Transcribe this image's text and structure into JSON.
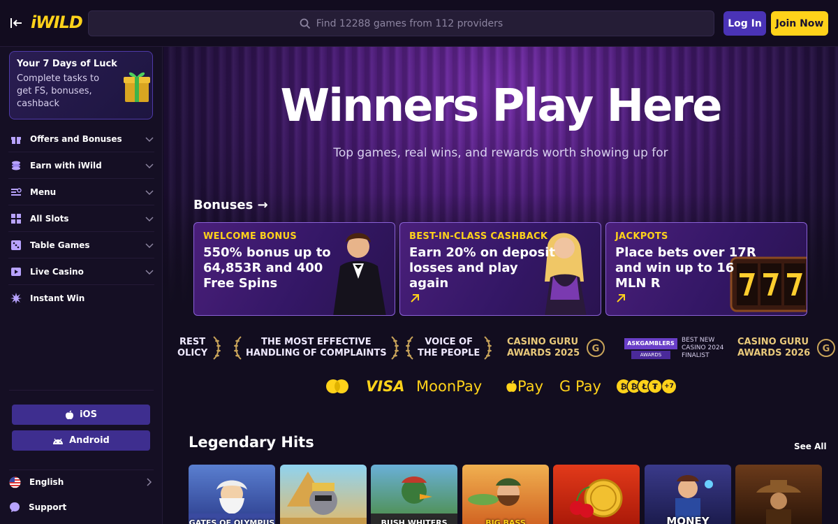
{
  "header": {
    "logo": "iWILD",
    "search_placeholder": "Find 12288 games from 112 providers",
    "login_label": "Log In",
    "join_label": "Join Now"
  },
  "sidebar": {
    "luck_card": {
      "title": "Your 7 Days of Luck",
      "description": "Complete tasks to get FS, bonuses, cashback"
    },
    "items": [
      {
        "label": "Offers and Bonuses",
        "icon": "gift-icon"
      },
      {
        "label": "Earn with iWild",
        "icon": "coins-icon"
      },
      {
        "label": "Menu",
        "icon": "menu-icon"
      },
      {
        "label": "All Slots",
        "icon": "grid-icon"
      },
      {
        "label": "Table Games",
        "icon": "dice-icon"
      },
      {
        "label": "Live Casino",
        "icon": "play-icon"
      },
      {
        "label": "Instant Win",
        "icon": "burst-icon"
      }
    ],
    "apps": {
      "ios": "iOS",
      "android": "Android"
    },
    "language": "English",
    "support": "Support"
  },
  "hero": {
    "title": "Winners Play Here",
    "subtitle": "Top games, real wins, and rewards worth showing up for"
  },
  "bonuses": {
    "heading": "Bonuses",
    "cards": [
      {
        "tag": "WELCOME BONUS",
        "text": "550% bonus up to 64,853R and 400 Free Spins"
      },
      {
        "tag": "BEST-IN-CLASS CASHBACK",
        "text": "Earn 20% on deposit losses and play again"
      },
      {
        "tag": "JACKPOTS",
        "text": "Place bets over 17R and win up to 16 MLN R"
      }
    ]
  },
  "awards": [
    {
      "line1": "REST",
      "line2": "OLICY"
    },
    {
      "line1": "THE MOST EFFECTIVE",
      "line2": "HANDLING OF COMPLAINTS"
    },
    {
      "line1": "VOICE OF",
      "line2": "THE PEOPLE"
    },
    {
      "line1": "CASINO GURU",
      "line2": "AWARDS 2025"
    },
    {
      "line1": "BEST NEW",
      "line2": "CASINO 2024",
      "line3": "FINALIST",
      "badge": "ASKGAMBLERS",
      "badge_sub": "AWARDS"
    },
    {
      "line1": "CASINO GURU",
      "line2": "AWARDS 2026"
    }
  ],
  "payments": [
    "VISA",
    "MoonPay",
    "Pay",
    "G Pay",
    "+7"
  ],
  "legendary": {
    "title": "Legendary Hits",
    "see_all": "See All",
    "games": [
      "GATES OF OLYMPUS",
      "",
      "BUSH WHITERS",
      "BIG BASS",
      "",
      "MONEY",
      ""
    ]
  },
  "colors": {
    "accent_yellow": "#ffd21a",
    "primary_purple": "#4a33b6",
    "background": "#120d1f"
  }
}
